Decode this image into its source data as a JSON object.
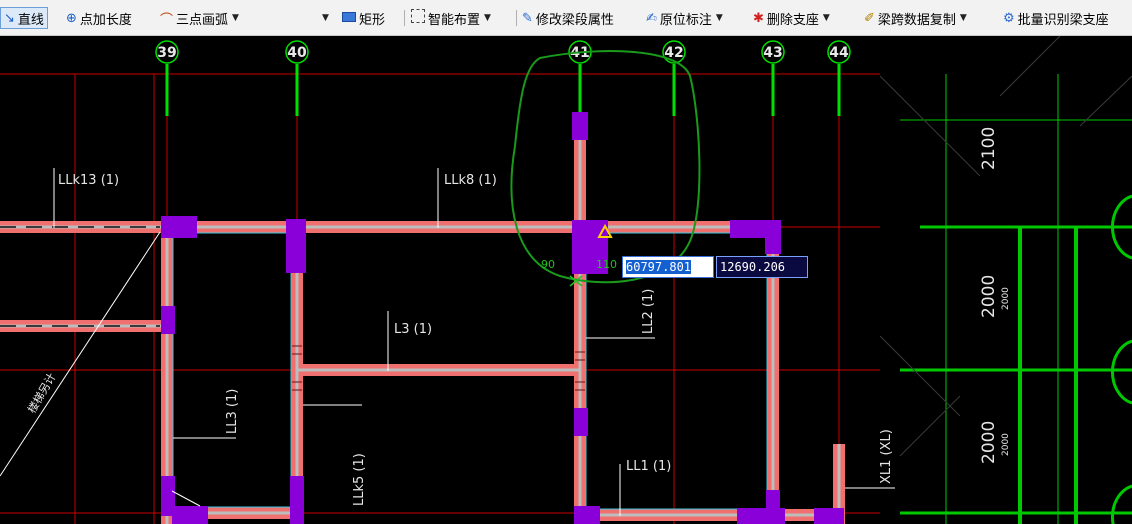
{
  "toolbar": {
    "items": [
      {
        "label": "直线",
        "icon": "line-icon"
      },
      {
        "label": "点加长度",
        "icon": "point-length-icon"
      },
      {
        "label": "三点画弧",
        "icon": "arc-icon"
      },
      {
        "label": "矩形",
        "icon": "rectangle-icon"
      },
      {
        "label": "智能布置",
        "icon": "smart-layout-icon"
      },
      {
        "label": "修改梁段属性",
        "icon": "edit-beam-icon"
      },
      {
        "label": "原位标注",
        "icon": "annotate-icon"
      },
      {
        "label": "删除支座",
        "icon": "delete-support-icon"
      },
      {
        "label": "梁跨数据复制",
        "icon": "copy-span-icon"
      },
      {
        "label": "批量识别梁支座",
        "icon": "batch-identify-icon"
      }
    ]
  },
  "axes": [
    "39",
    "40",
    "41",
    "42",
    "43",
    "44"
  ],
  "beams": [
    "LLk13 (1)",
    "LLk8 (1)",
    "L3 (1)",
    "LL2 (1)",
    "LL3 (1)",
    "LLk5 (1)",
    "LL1 (1)",
    "XL1 (XL)",
    "楼梯另计"
  ],
  "dimensions": [
    {
      "big": "2100",
      "small": ""
    },
    {
      "big": "2000",
      "small": "2000"
    },
    {
      "big": "2000",
      "small": "2000"
    }
  ],
  "angles": [
    "90",
    "110"
  ],
  "coords": {
    "x": "60797.801",
    "y": "12690.206"
  },
  "colors": {
    "beam": "#f07070",
    "beam_core": "#bdbdbd",
    "column": "#8a00d8",
    "axis": "#cc0000",
    "axis_bubble": "#00e000",
    "highlight": "#1a9a1a"
  }
}
